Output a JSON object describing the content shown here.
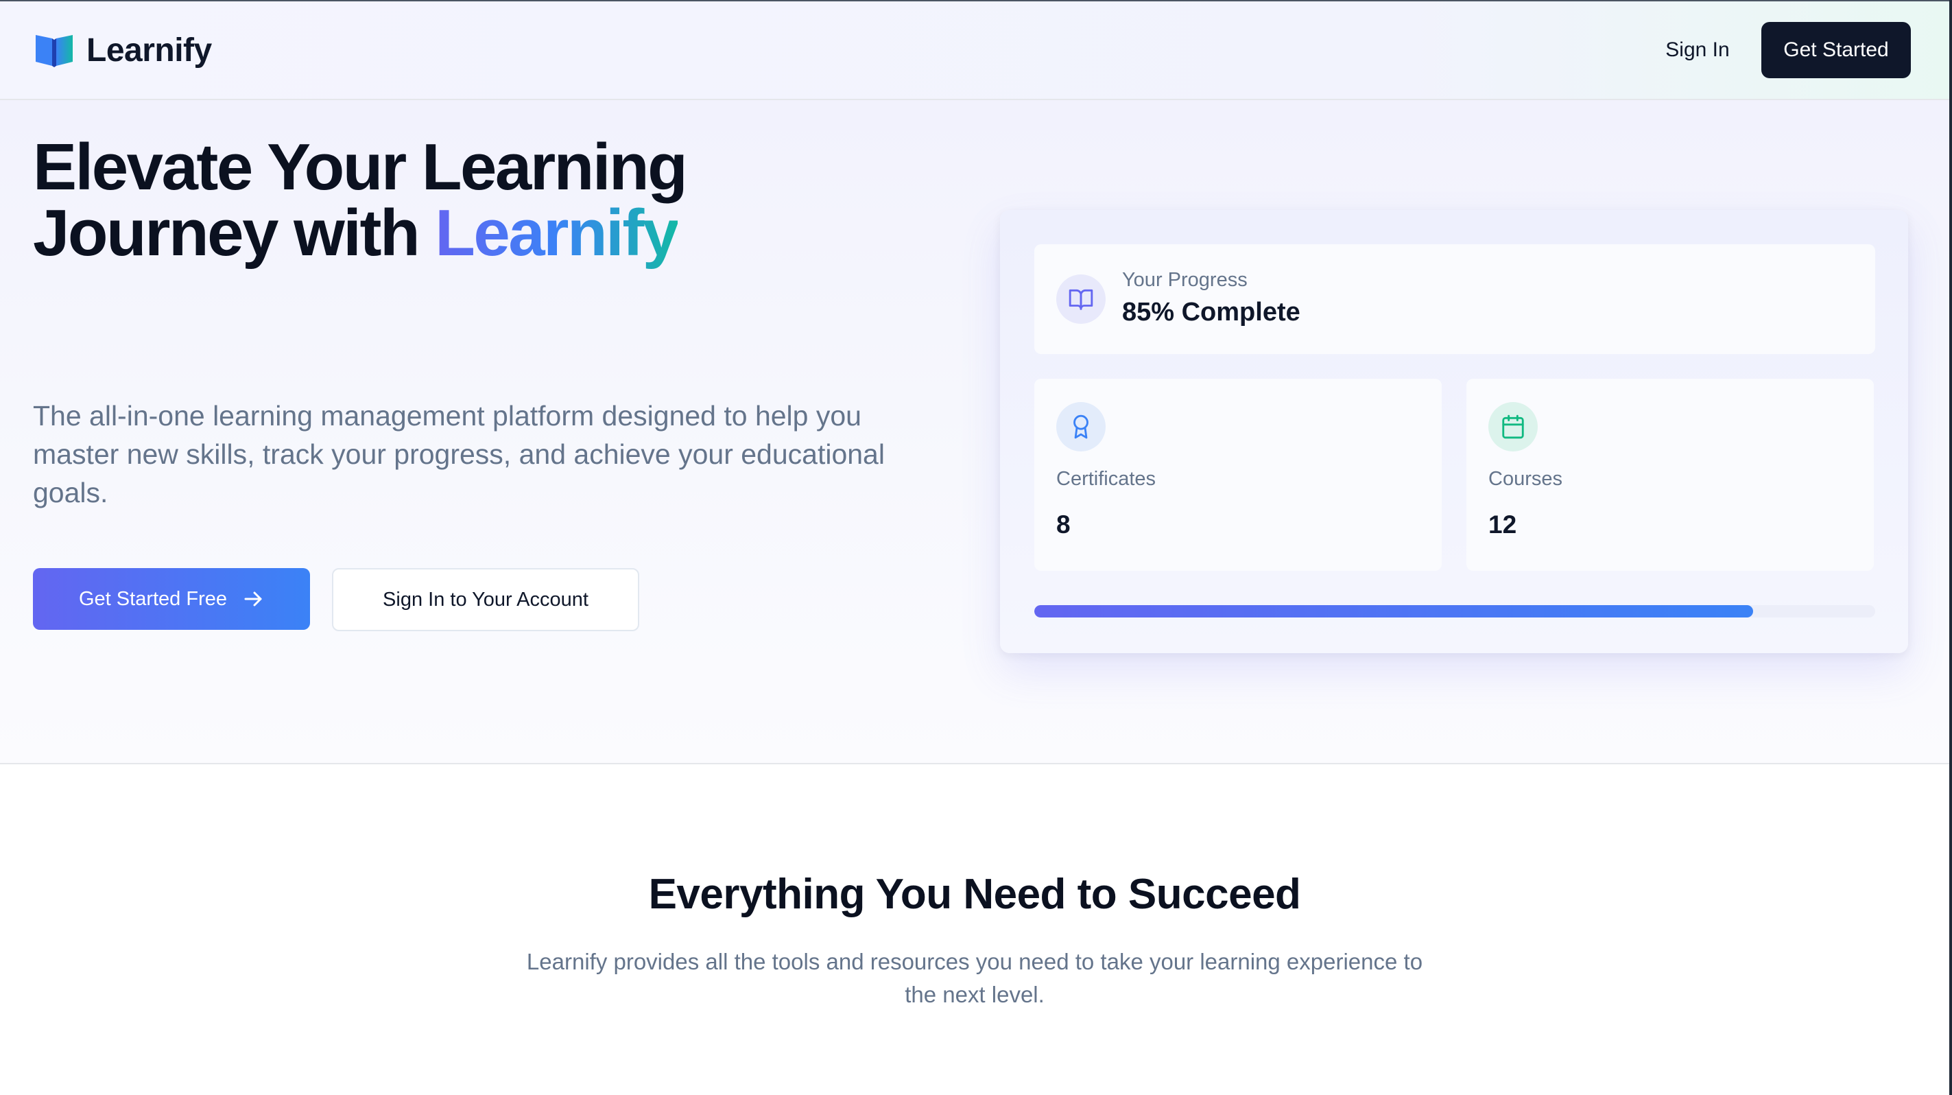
{
  "header": {
    "brand_name": "Learnify",
    "logo_icon": "open-book-icon",
    "sign_in_label": "Sign In",
    "get_started_label": "Get Started"
  },
  "hero": {
    "title_line1": "Elevate Your Learning",
    "title_line2_prefix": "Journey with ",
    "title_brand": "Learnify",
    "subtitle": "The all-in-one learning management platform designed to help you master new skills, track your progress, and achieve your educational goals.",
    "primary_cta": "Get Started Free",
    "primary_cta_icon": "arrow-right-icon",
    "secondary_cta": "Sign In to Your Account"
  },
  "dashboard": {
    "progress": {
      "icon": "book-open-icon",
      "label": "Your Progress",
      "value": "85% Complete"
    },
    "certificates": {
      "icon": "award-icon",
      "label": "Certificates",
      "value": "8"
    },
    "courses": {
      "icon": "calendar-icon",
      "label": "Courses",
      "value": "12"
    },
    "progress_bar_fraction": 0.855
  },
  "features": {
    "title": "Everything You Need to Succeed",
    "subtitle": "Learnify provides all the tools and resources you need to take your learning experience to the next level."
  },
  "colors": {
    "primary_gradient_start": "#6366f1",
    "primary_gradient_end": "#3b82f6",
    "brand_teal": "#14b8a6",
    "dark_navy": "#0f172a",
    "muted_text": "#64748b",
    "certificate_icon": "#3b82f6",
    "courses_icon": "#10b981"
  }
}
